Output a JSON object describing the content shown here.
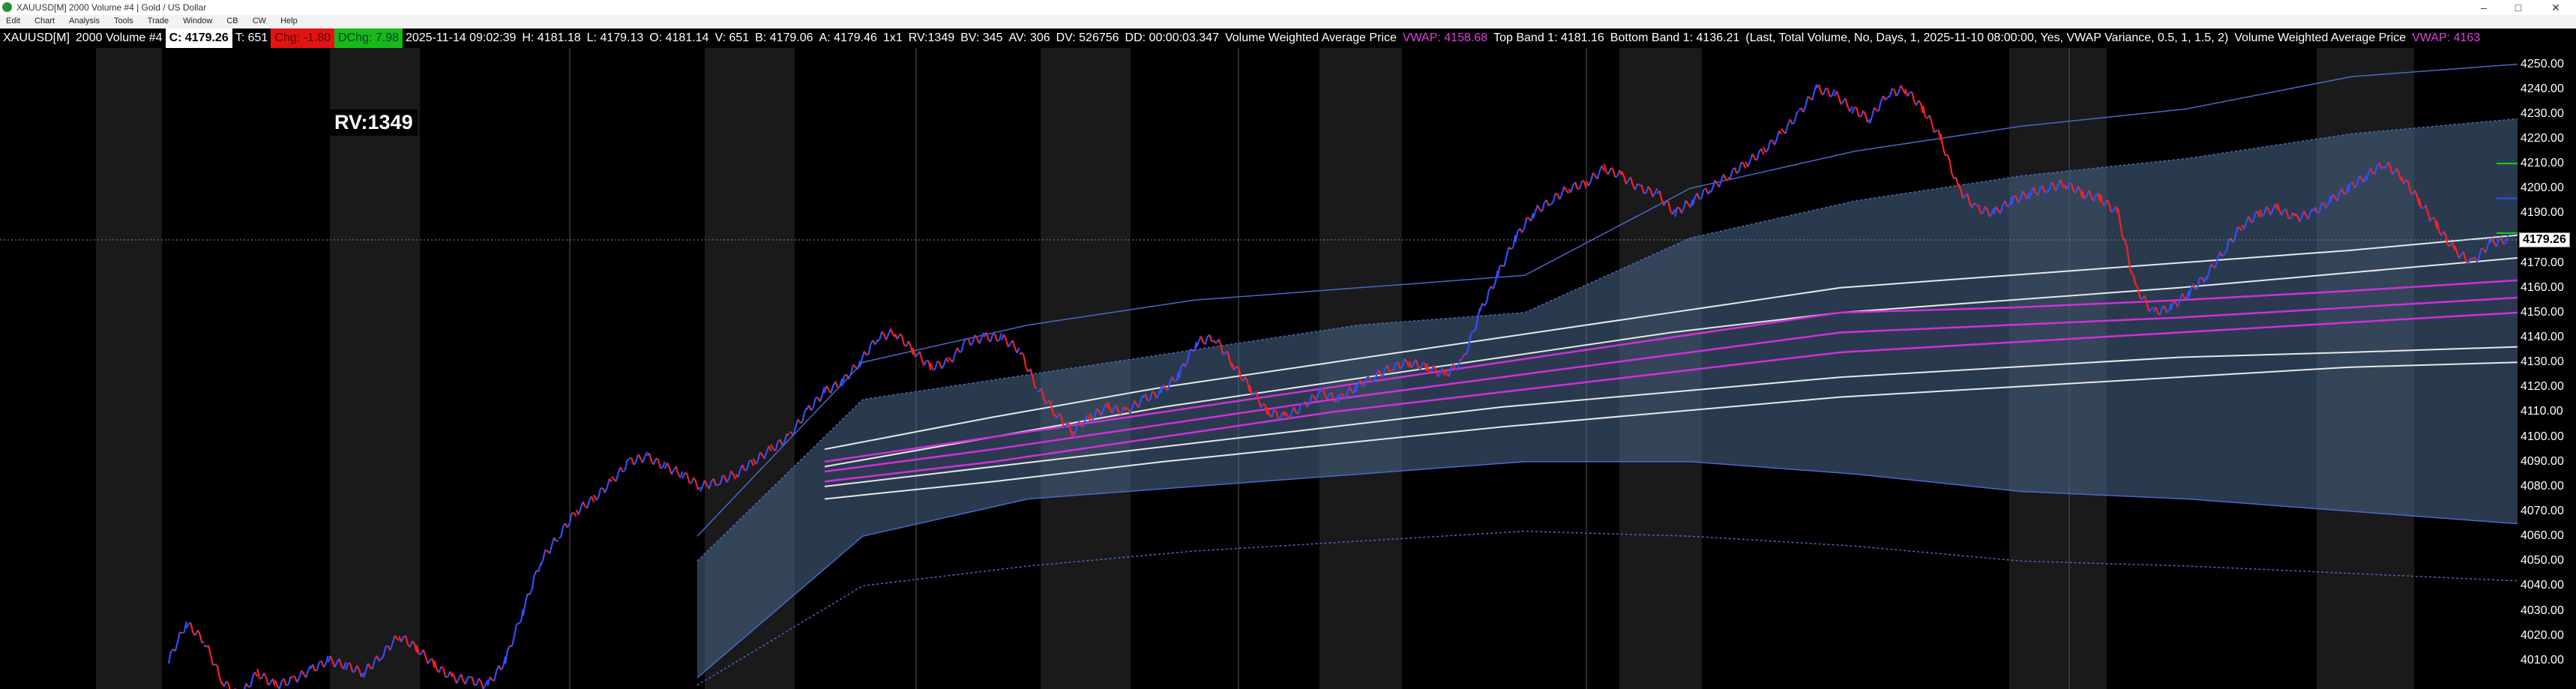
{
  "window": {
    "title": "XAUUSD[M]  2000 Volume #4 | Gold / US Dollar",
    "minimize": "–",
    "maximize": "□",
    "close": "✕"
  },
  "menu": [
    "Edit",
    "Chart",
    "Analysis",
    "Tools",
    "Trade",
    "Window",
    "CB",
    "CW",
    "Help"
  ],
  "infobar": {
    "symbol": "XAUUSD[M]",
    "series": "2000 Volume #4",
    "close": "C: 4179.26",
    "ticks": "T: 651",
    "chg": "Chg: -1.80",
    "dchg": "DChg: 7.98",
    "datetime": "2025-11-14 09:02:39",
    "high": "H: 4181.18",
    "low": "L: 4179.13",
    "open": "O: 4181.14",
    "volume": "V: 651",
    "bid": "B: 4179.06",
    "ask": "A: 4179.46",
    "ratio": "1x1",
    "rv": "RV:1349",
    "bv": "BV: 345",
    "av": "AV: 306",
    "dv": "DV: 526756",
    "dd": "DD: 00:00:03.347",
    "study_name": "Volume Weighted Average Price",
    "vwap": "VWAP: 4158.68",
    "top_band": "Top Band 1: 4181.16",
    "bottom_band": "Bottom Band 1: 4136.21",
    "study_params": "(Last, Total Volume, No, Days, 1, 2025-11-10  08:00:00, Yes, VWAP Variance, 0.5, 1, 1.5, 2)",
    "study_name_2": "Volume Weighted Average Price",
    "vwap_2": "VWAP: 4163"
  },
  "rv_label": "RV:1349",
  "current_price": "4179.26",
  "colors": {
    "up_bar": "#3050ff",
    "down_bar": "#ff2020",
    "vwap": "#d030d8",
    "band": "#e8e8e8",
    "fill": "#4a6a8e",
    "session_shade": "#1a1a1a"
  },
  "chart_data": {
    "type": "line",
    "ylim": [
      4000,
      4255
    ],
    "yticks": [
      4250,
      4240,
      4230,
      4220,
      4210,
      4200,
      4190,
      4180,
      4170,
      4160,
      4150,
      4140,
      4130,
      4120,
      4110,
      4100,
      4090,
      4080,
      4070,
      4060,
      4050,
      4040,
      4030,
      4020,
      4010
    ],
    "price_path": [
      4010,
      4025,
      4018,
      4002,
      3995,
      4005,
      4000,
      4002,
      4006,
      4010,
      4008,
      4005,
      4012,
      4020,
      4015,
      4008,
      4003,
      4002,
      4000,
      4010,
      4030,
      4050,
      4060,
      4070,
      4075,
      4082,
      4090,
      4092,
      4088,
      4085,
      4080,
      4082,
      4085,
      4090,
      4095,
      4100,
      4110,
      4118,
      4122,
      4130,
      4140,
      4142,
      4135,
      4128,
      4130,
      4138,
      4140,
      4140,
      4135,
      4120,
      4110,
      4102,
      4108,
      4112,
      4110,
      4115,
      4118,
      4125,
      4138,
      4140,
      4130,
      4120,
      4110,
      4108,
      4112,
      4118,
      4115,
      4120,
      4124,
      4128,
      4130,
      4128,
      4125,
      4130,
      4150,
      4165,
      4180,
      4190,
      4195,
      4200,
      4202,
      4208,
      4205,
      4200,
      4198,
      4190,
      4195,
      4200,
      4205,
      4210,
      4215,
      4222,
      4230,
      4240,
      4238,
      4232,
      4228,
      4238,
      4240,
      4232,
      4220,
      4200,
      4192,
      4190,
      4195,
      4198,
      4200,
      4202,
      4198,
      4196,
      4190,
      4160,
      4150,
      4152,
      4158,
      4165,
      4175,
      4185,
      4190,
      4192,
      4188,
      4190,
      4195,
      4200,
      4205,
      4210,
      4205,
      4195,
      4185,
      4175,
      4170,
      4178,
      4179.26
    ],
    "vwap_lines": [
      [
        4090,
        4100,
        4110,
        4120,
        4130,
        4140,
        4150,
        4152,
        4155,
        4158.68,
        4163
      ],
      [
        4086,
        4095,
        4105,
        4115,
        4124,
        4133,
        4142,
        4145,
        4148,
        4152,
        4156
      ],
      [
        4082,
        4090,
        4100,
        4110,
        4118,
        4126,
        4134,
        4138,
        4142,
        4146,
        4150
      ]
    ],
    "band_lines": [
      [
        4095,
        4108,
        4120,
        4130,
        4140,
        4150,
        4160,
        4165,
        4170,
        4175,
        4181.16
      ],
      [
        4088,
        4100,
        4112,
        4122,
        4132,
        4142,
        4150,
        4155,
        4160,
        4166,
        4172
      ],
      [
        4080,
        4088,
        4096,
        4104,
        4112,
        4118,
        4124,
        4128,
        4132,
        4134,
        4136.21
      ],
      [
        4075,
        4082,
        4090,
        4097,
        4104,
        4110,
        4116,
        4120,
        4124,
        4128,
        4130
      ]
    ],
    "outer_bands": [
      [
        4060,
        4130,
        4145,
        4155,
        4160,
        4165,
        4200,
        4215,
        4225,
        4232,
        4245,
        4250
      ],
      [
        4050,
        4115,
        4125,
        4135,
        4145,
        4150,
        4180,
        4195,
        4205,
        4212,
        4222,
        4228
      ],
      [
        4003,
        4060,
        4075,
        4080,
        4085,
        4090,
        4090,
        4085,
        4078,
        4075,
        4070,
        4065
      ],
      [
        4000,
        4040,
        4048,
        4054,
        4058,
        4062,
        4060,
        4056,
        4050,
        4048,
        4045,
        4042
      ]
    ]
  }
}
